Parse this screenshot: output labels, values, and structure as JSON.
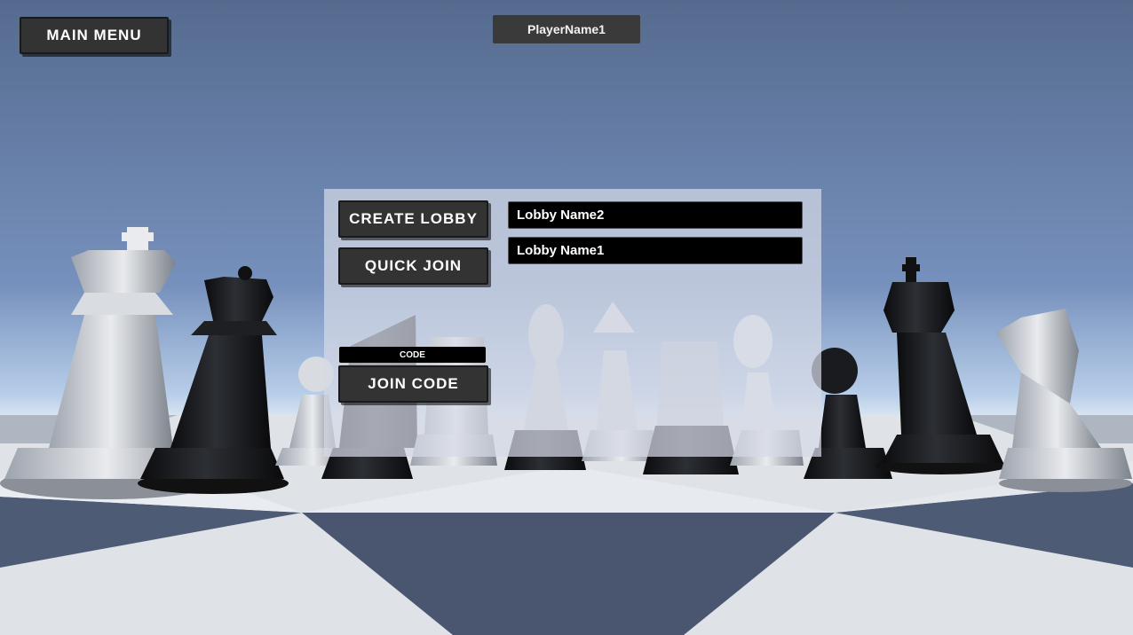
{
  "header": {
    "main_menu_label": "MAIN MENU",
    "player_name": "PlayerName1"
  },
  "lobby_panel": {
    "create_lobby_label": "CREATE LOBBY",
    "quick_join_label": "QUICK JOIN",
    "code_placeholder": "CODE",
    "join_code_label": "JOIN CODE",
    "lobbies": [
      {
        "name": "Lobby Name2"
      },
      {
        "name": "Lobby Name1"
      }
    ]
  },
  "colors": {
    "sky_top": "#5a6d90",
    "sky_horizon": "#b9d0ea",
    "button_bg": "#333333",
    "board_light": "#e6e8eb",
    "board_dark": "#4d5b74"
  }
}
